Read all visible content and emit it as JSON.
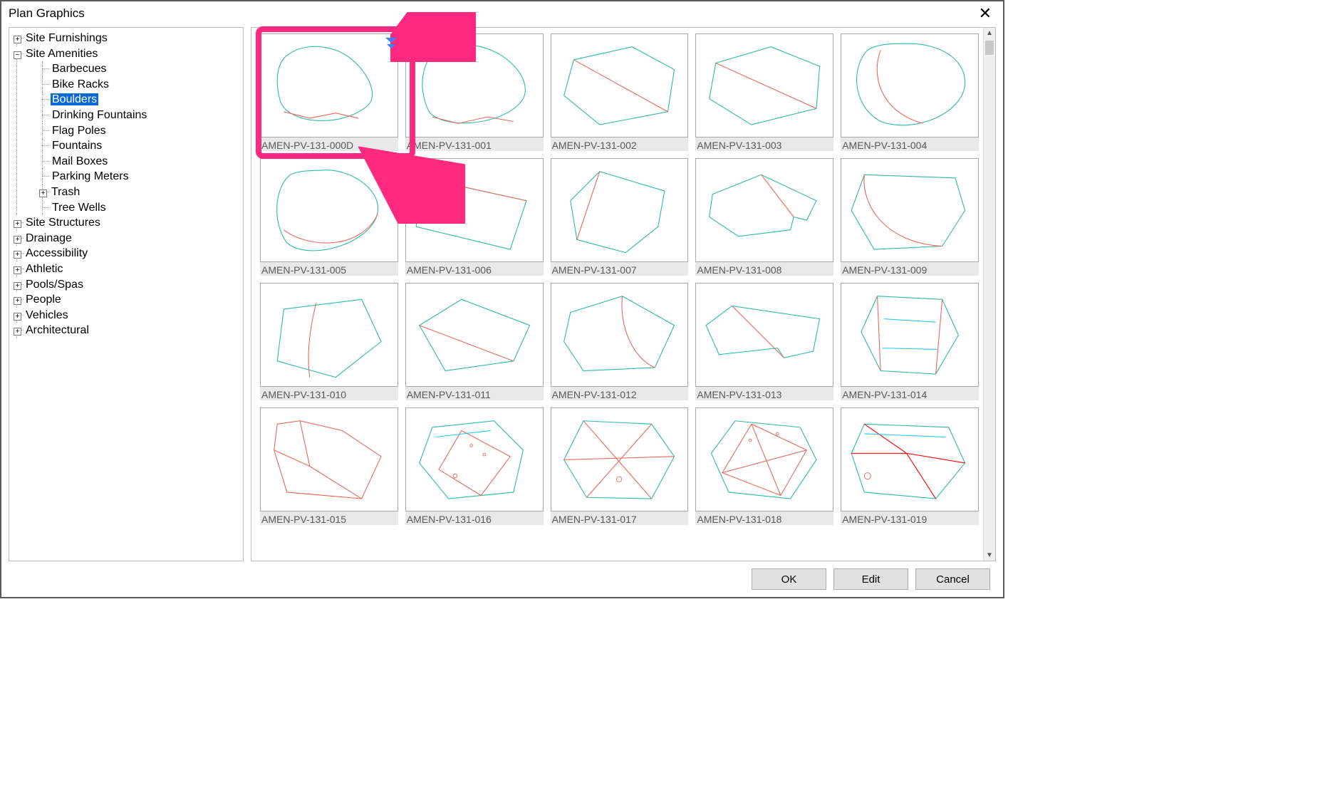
{
  "dialog": {
    "title": "Plan Graphics"
  },
  "buttons": {
    "ok": "OK",
    "edit": "Edit",
    "cancel": "Cancel"
  },
  "tree": {
    "site_furnishings": "Site Furnishings",
    "site_amenities": "Site Amenities",
    "barbecues": "Barbecues",
    "bike_racks": "Bike Racks",
    "boulders": "Boulders",
    "drinking_fountains": "Drinking Fountains",
    "flag_poles": "Flag Poles",
    "fountains": "Fountains",
    "mail_boxes": "Mail Boxes",
    "parking_meters": "Parking Meters",
    "trash": "Trash",
    "tree_wells": "Tree Wells",
    "site_structures": "Site Structures",
    "drainage": "Drainage",
    "accessibility": "Accessibility",
    "athletic": "Athletic",
    "pools_spas": "Pools/Spas",
    "people": "People",
    "vehicles": "Vehicles",
    "architectural": "Architectural"
  },
  "thumbs": [
    "AMEN-PV-131-000D",
    "AMEN-PV-131-001",
    "AMEN-PV-131-002",
    "AMEN-PV-131-003",
    "AMEN-PV-131-004",
    "AMEN-PV-131-005",
    "AMEN-PV-131-006",
    "AMEN-PV-131-007",
    "AMEN-PV-131-008",
    "AMEN-PV-131-009",
    "AMEN-PV-131-010",
    "AMEN-PV-131-011",
    "AMEN-PV-131-012",
    "AMEN-PV-131-013",
    "AMEN-PV-131-014",
    "AMEN-PV-131-015",
    "AMEN-PV-131-016",
    "AMEN-PV-131-017",
    "AMEN-PV-131-018",
    "AMEN-PV-131-019"
  ],
  "svgs": [
    "<path class='teal' d='M40 20 C20 30 15 60 25 95 C40 130 120 135 160 100 C180 80 150 30 110 15 C80 5 55 10 40 20 Z'/><path class='red' d='M30 110 L70 120 L110 112 L145 120'/>",
    "<path class='teal' d='M50 10 C20 25 10 70 30 110 C55 140 150 130 175 90 C190 60 150 15 100 8 C80 5 60 5 50 10 Z'/><path class='red' d='M35 118 L75 128 L120 118 L160 125'/>",
    "<path class='teal' d='M30 30 L120 10 L185 45 L175 110 L70 130 L15 85 Z'/><path class='red' d='M30 30 L175 110'/>",
    "<path class='teal' d='M25 35 L110 10 L185 40 L180 105 L80 130 L15 90 Z'/><path class='red' d='M25 35 L180 105'/>",
    "<path class='teal' d='M35 15 C10 40 10 100 55 125 C110 145 185 110 185 65 C185 25 140 5 100 5 C75 5 50 5 35 15 Z'/><path class='red' d='M55 15 C40 55 55 110 120 128'/>",
    "<path class='teal' d='M40 15 C15 35 12 90 35 120 C70 150 170 120 175 70 C178 35 130 5 90 8 C70 9 55 8 40 15 Z'/><path class='red' d='M30 100 C70 130 150 130 175 75'/>",
    "<path class='teal' d='M20 20 L180 55 L155 130 L10 95 Z'/><path class='red' d='M20 20 L180 55'/>",
    "<path class='teal' d='M70 10 L170 40 L160 95 L110 135 L35 115 L25 55 Z'/><path class='red' d='M70 10 L35 115'/>",
    "<path class='teal' d='M20 45 L95 15 L180 55 L165 85 L145 80 L140 100 L60 110 L15 80 Z'/><path class='red' d='M95 15 L145 80'/>",
    "<path class='teal' d='M30 15 L170 20 L185 70 L150 125 L45 130 L10 70 Z'/><path class='red' d='M30 15 C25 60 60 120 150 125'/>",
    "<path class='teal' d='M30 30 L150 15 L180 80 L110 135 L20 110 Z'/><path class='red' d='M80 20 C70 60 65 100 70 135'/>",
    "<path class='teal' d='M15 55 L80 15 L185 55 L160 110 L55 125 Z'/><path class='red' d='M15 55 L160 110'/>",
    "<path class='teal' d='M25 35 L105 10 L185 55 L155 120 L45 125 L15 80 Z'/><path class='red' d='M105 10 C100 55 120 105 155 120'/>",
    "<path class='teal' d='M10 55 L50 25 L185 45 L175 95 L130 105 L120 90 L30 100 Z'/><path class='red' d='M50 25 L130 105'/>",
    "<path class='teal' d='M50 10 L150 15 L175 70 L140 130 L55 125 L25 65 Z'/><path class='red' d='M50 10 L55 125 M150 15 L140 130'/><path class='cyan' d='M60 45 L140 50 M58 90 L142 92'/>",
    "<path class='red' d='M20 15 L55 10 L120 25 L180 65 L150 130 L35 120 L15 55 Z'/><path class='red' d='M55 10 L70 80 L150 130 M15 55 L70 80'/>",
    "<path class='teal' d='M35 20 L130 10 L175 55 L160 120 L60 130 L15 75 Z'/><path class='red' d='M80 25 L155 65 L110 125 L45 85 Z'/><path class='cyan' d='M40 35 L125 25'/><circle cx='70' cy='95' r='3' class='red' fill='none'/><circle cx='115' cy='62' r='2' class='red' fill='none'/><circle cx='95' cy='48' r='2' class='red' fill='none'/>",
    "<path class='teal' d='M45 10 L150 15 L185 65 L150 130 L50 128 L15 70 Z'/><path class='red' d='M45 10 L150 130 M150 15 L50 128 M15 70 L185 65'/><circle cx='100' cy='100' r='4' class='red' fill='none'/>",
    "<path class='teal' d='M55 10 L155 20 L180 70 L140 130 L45 120 L18 60 Z'/><path class='red' d='M80 15 L165 55 L125 125 L35 90 Z M80 15 L125 125 M35 90 L165 55'/><circle cx='78' cy='40' r='2' class='red' fill='none'/><circle cx='120' cy='30' r='2' class='red' fill='none'/>",
    "<path class='teal' d='M30 15 L160 20 L185 75 L140 130 L30 120 L10 60 Z'/><path class='red2' d='M30 15 L95 60 L185 75 M10 60 L95 60 L140 130'/><path class='cyan' d='M30 30 L155 35'/><circle cx='35' cy='95' r='5' class='red' fill='none'/>"
  ]
}
